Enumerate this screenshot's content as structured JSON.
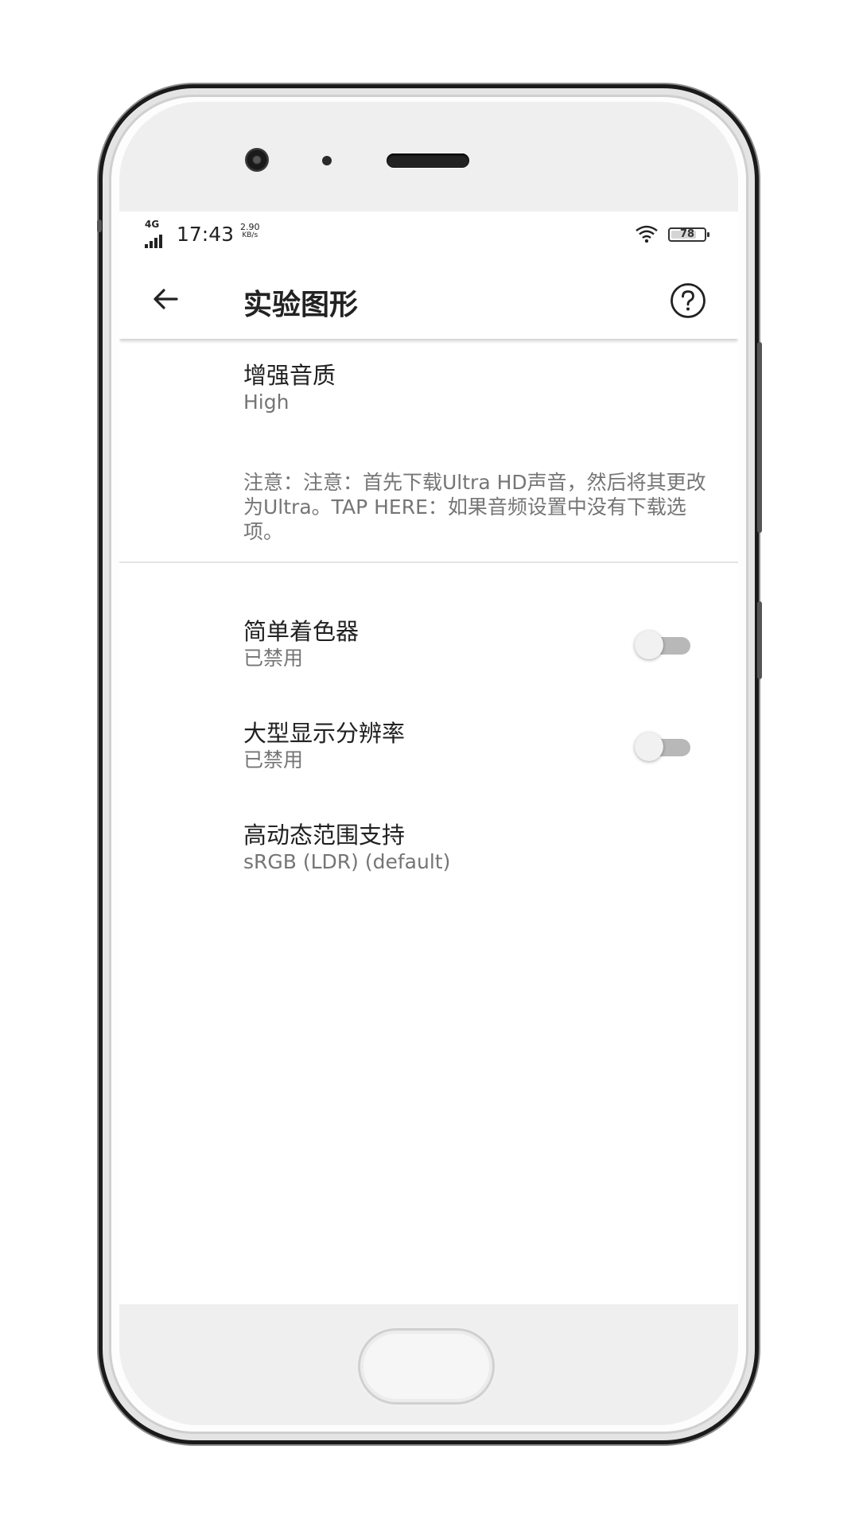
{
  "status_bar": {
    "network": "4G",
    "time": "17:43",
    "speed_value": "2.90",
    "speed_unit": "KB/s",
    "battery": "78",
    "battery_level": 0.78
  },
  "app_bar": {
    "title": "实验图形",
    "back_icon": "arrow-left-icon",
    "help_icon": "help-circle-icon"
  },
  "preferences": {
    "audio_quality": {
      "title": "增强音质",
      "summary": "High"
    },
    "note": "注意：注意：首先下载Ultra HD声音，然后将其更改为Ultra。TAP HERE：如果音频设置中没有下载选项。",
    "simple_shader": {
      "title": "简单着色器",
      "summary": "已禁用",
      "enabled": false
    },
    "large_display": {
      "title": "大型显示分辨率",
      "summary": "已禁用",
      "enabled": false
    },
    "hdr_support": {
      "title": "高动态范围支持",
      "summary": "sRGB (LDR) (default)"
    }
  },
  "colors": {
    "text_primary": "#212121",
    "text_secondary": "#757575",
    "toggle_track_off": "#b8b8b8",
    "toggle_thumb_off": "#f1f1f1"
  }
}
